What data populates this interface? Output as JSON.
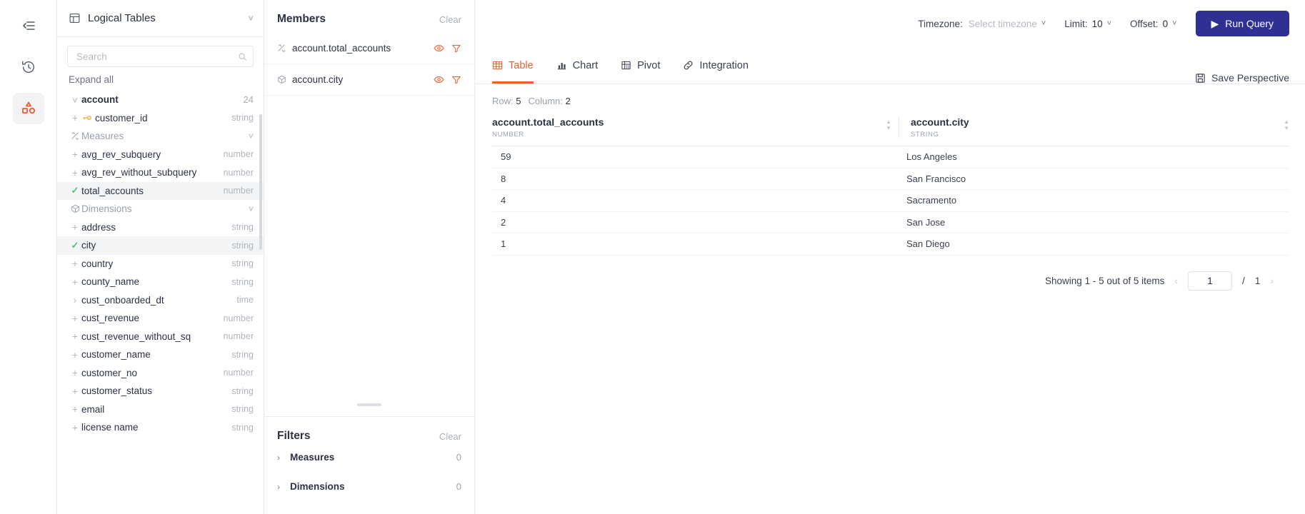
{
  "rail": {
    "items": [
      {
        "name": "collapse-panel-icon",
        "active": false
      },
      {
        "name": "history-icon",
        "active": false
      },
      {
        "name": "schema-icon",
        "active": true
      }
    ]
  },
  "fields_panel": {
    "title": "Logical Tables",
    "search_placeholder": "Search",
    "search_value": "",
    "expand_all": "Expand all",
    "rows": [
      {
        "kind": "table",
        "lead": "chevron-down",
        "label": "account",
        "meta": "24",
        "selected": false
      },
      {
        "kind": "field",
        "lead": "plus",
        "icon": "key",
        "label": "customer_id",
        "meta": "string",
        "selected": false
      },
      {
        "kind": "group",
        "lead": "measures",
        "label": "Measures",
        "meta": "chevron-down",
        "selected": false
      },
      {
        "kind": "field",
        "lead": "plus",
        "label": "avg_rev_subquery",
        "meta": "number",
        "selected": false
      },
      {
        "kind": "field",
        "lead": "plus",
        "label": "avg_rev_without_subquery",
        "meta": "number",
        "selected": false
      },
      {
        "kind": "field",
        "lead": "check",
        "label": "total_accounts",
        "meta": "number",
        "selected": true
      },
      {
        "kind": "group",
        "lead": "dimensions",
        "label": "Dimensions",
        "meta": "chevron-down",
        "selected": false
      },
      {
        "kind": "field",
        "lead": "plus",
        "label": "address",
        "meta": "string",
        "selected": false
      },
      {
        "kind": "field",
        "lead": "check",
        "label": "city",
        "meta": "string",
        "selected": true
      },
      {
        "kind": "field",
        "lead": "plus",
        "label": "country",
        "meta": "string",
        "selected": false
      },
      {
        "kind": "field",
        "lead": "plus",
        "label": "county_name",
        "meta": "string",
        "selected": false
      },
      {
        "kind": "field",
        "lead": "caret-right",
        "label": "cust_onboarded_dt",
        "meta": "time",
        "selected": false
      },
      {
        "kind": "field",
        "lead": "plus",
        "label": "cust_revenue",
        "meta": "number",
        "selected": false
      },
      {
        "kind": "field",
        "lead": "plus",
        "label": "cust_revenue_without_sq",
        "meta": "number",
        "selected": false
      },
      {
        "kind": "field",
        "lead": "plus",
        "label": "customer_name",
        "meta": "string",
        "selected": false
      },
      {
        "kind": "field",
        "lead": "plus",
        "label": "customer_no",
        "meta": "number",
        "selected": false
      },
      {
        "kind": "field",
        "lead": "plus",
        "label": "customer_status",
        "meta": "string",
        "selected": false
      },
      {
        "kind": "field",
        "lead": "plus",
        "label": "email",
        "meta": "string",
        "selected": false
      },
      {
        "kind": "field",
        "lead": "plus",
        "label": "license name",
        "meta": "string",
        "selected": false
      }
    ]
  },
  "members_panel": {
    "title": "Members",
    "clear_label": "Clear",
    "items": [
      {
        "icon": "measure-icon",
        "label": "account.total_accounts"
      },
      {
        "icon": "dimension-icon",
        "label": "account.city"
      }
    ]
  },
  "filters_panel": {
    "title": "Filters",
    "clear_label": "Clear",
    "groups": [
      {
        "label": "Measures",
        "count": "0"
      },
      {
        "label": "Dimensions",
        "count": "0"
      }
    ]
  },
  "topbar": {
    "timezone_label": "Timezone:",
    "timezone_value": "Select timezone",
    "limit_label": "Limit:",
    "limit_value": "10",
    "offset_label": "Offset:",
    "offset_value": "0",
    "run_query_label": "Run Query"
  },
  "tabs": [
    {
      "label": "Table",
      "icon": "table-icon",
      "active": true
    },
    {
      "label": "Chart",
      "icon": "chart-icon",
      "active": false
    },
    {
      "label": "Pivot",
      "icon": "pivot-icon",
      "active": false
    },
    {
      "label": "Integration",
      "icon": "link-icon",
      "active": false
    }
  ],
  "save_perspective_label": "Save Perspective",
  "result": {
    "row_label": "Row:",
    "row_count": "5",
    "column_label": "Column:",
    "column_count": "2",
    "columns": [
      {
        "name": "account.total_accounts",
        "type": "NUMBER"
      },
      {
        "name": "account.city",
        "type": "STRING"
      }
    ],
    "rows": [
      {
        "total_accounts": "59",
        "city": "Los Angeles"
      },
      {
        "total_accounts": "8",
        "city": "San Francisco"
      },
      {
        "total_accounts": "4",
        "city": "Sacramento"
      },
      {
        "total_accounts": "2",
        "city": "San Jose"
      },
      {
        "total_accounts": "1",
        "city": "San Diego"
      }
    ],
    "pagination": {
      "showing": "Showing 1 - 5 out of 5 items",
      "page_value": "1",
      "separator": "/",
      "total_pages": "1"
    }
  },
  "colors": {
    "accent_orange": "#ed5c30",
    "primary_blue": "#2f3192",
    "check_green": "#5bbd72",
    "key_yellow": "#f0a92a"
  }
}
